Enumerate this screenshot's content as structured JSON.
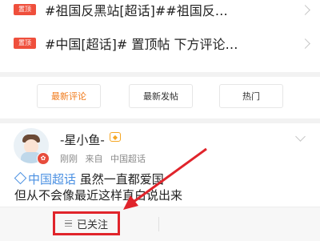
{
  "pinned_posts": [
    {
      "badge": "置顶",
      "title": "#祖国反黑站[超话]##祖国反…"
    },
    {
      "badge": "置顶",
      "title": "#中国[超话]# 置顶帖 下方评论…"
    }
  ],
  "tabs": [
    {
      "label": "最新评论",
      "active": true
    },
    {
      "label": "最新发帖",
      "active": false
    },
    {
      "label": "热门",
      "active": false
    }
  ],
  "post": {
    "username": "-星小鱼-",
    "vip_icon": "vip-diamond-icon",
    "time": "刚刚",
    "source_prefix": "来自",
    "source": "中国超话",
    "topic": "中国超话",
    "line1_rest": " 虽然一直都爱国",
    "line2": "但从不会像最近这样直白说出来"
  },
  "bottom_bar": {
    "follow_label": "已关注"
  },
  "colors": {
    "accent": "#f07a1a",
    "pin_badge": "#ef4f3c",
    "link": "#4a90e2",
    "highlight": "#e0242b"
  }
}
